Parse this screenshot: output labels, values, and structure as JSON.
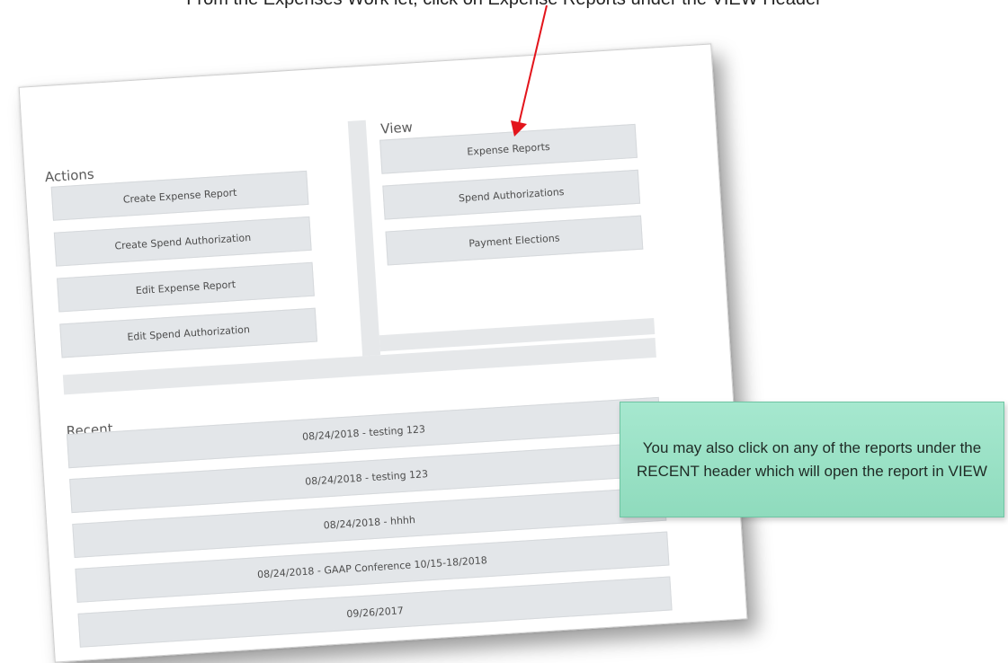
{
  "caption": {
    "top_text": "From the Expenses Work let, click on Expense Reports under the VIEW Header"
  },
  "actions": {
    "title": "Actions",
    "buttons": [
      "Create Expense Report",
      "Create Spend Authorization",
      "Edit Expense Report",
      "Edit Spend Authorization"
    ]
  },
  "view": {
    "title": "View",
    "buttons": [
      "Expense Reports",
      "Spend Authorizations",
      "Payment Elections"
    ]
  },
  "recent": {
    "title": "Recent",
    "items": [
      "08/24/2018 - testing 123",
      "08/24/2018 - testing 123",
      "08/24/2018 - hhhh",
      "08/24/2018 - GAAP Conference 10/15-18/2018",
      "09/26/2017"
    ]
  },
  "callout": {
    "text": "You may also click on any of the reports under the RECENT header which will open the report in VIEW"
  },
  "colors": {
    "arrow": "#e3141b",
    "button_bg": "#e3e6e9",
    "callout_bg": "#98dfc3"
  }
}
